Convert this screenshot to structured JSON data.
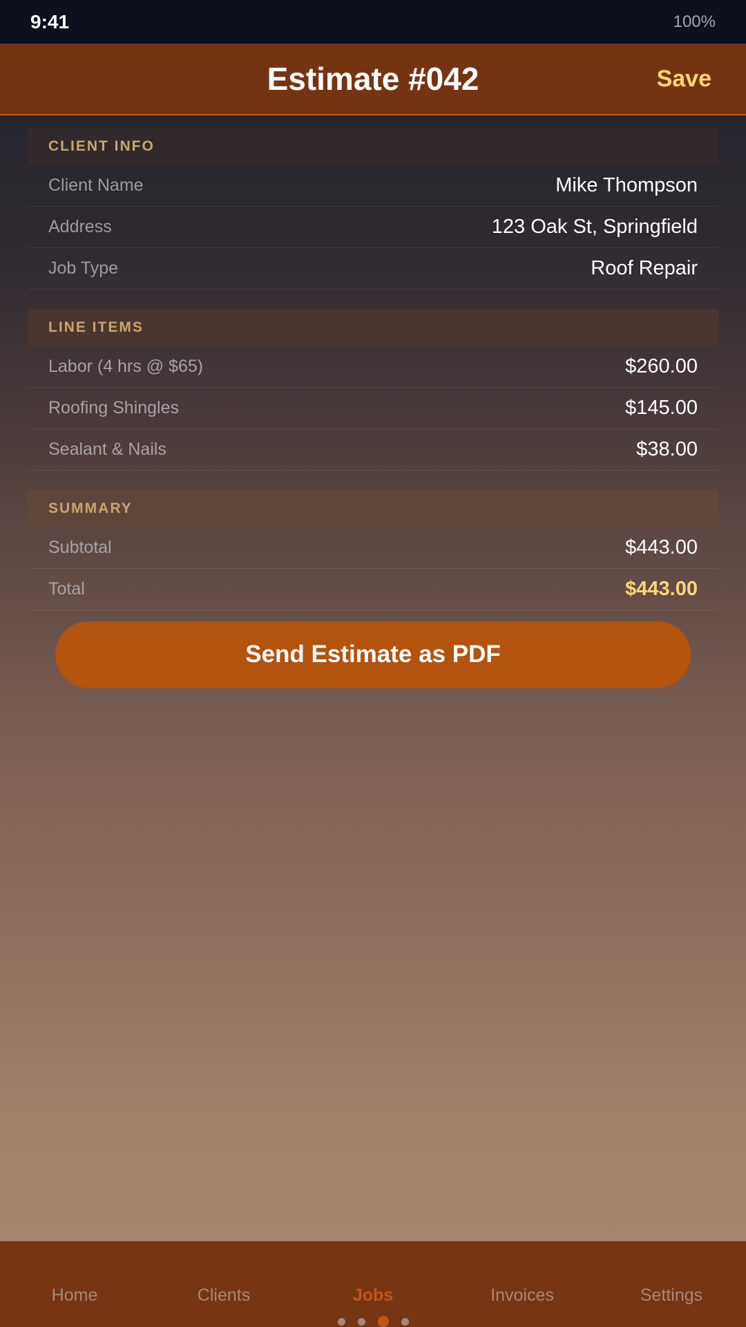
{
  "status_bar": {
    "time": "9:41",
    "battery": "100%"
  },
  "header": {
    "title": "Estimate #042",
    "save_label": "Save"
  },
  "sections": {
    "client_info": {
      "title": "CLIENT INFO",
      "rows": [
        {
          "label": "Client Name",
          "value": "Mike Thompson"
        },
        {
          "label": "Address",
          "value": "123 Oak St, Springfield"
        },
        {
          "label": "Job Type",
          "value": "Roof Repair"
        }
      ]
    },
    "line_items": {
      "title": "LINE ITEMS",
      "rows": [
        {
          "label": "Labor (4 hrs @ $65)",
          "value": "$260.00"
        },
        {
          "label": "Roofing Shingles",
          "value": "$145.00"
        },
        {
          "label": "Sealant & Nails",
          "value": "$38.00"
        }
      ]
    },
    "summary": {
      "title": "SUMMARY",
      "rows": [
        {
          "label": "Subtotal",
          "value": "$443.00"
        },
        {
          "label": "Total",
          "value": "$443.00"
        }
      ]
    }
  },
  "send_button_label": "Send Estimate as PDF",
  "tab_bar": {
    "tabs": [
      {
        "label": "Home"
      },
      {
        "label": "Clients"
      },
      {
        "label": "Jobs"
      },
      {
        "label": "Invoices"
      },
      {
        "label": "Settings"
      }
    ],
    "active_tab": "Jobs"
  },
  "page_indicator": {
    "total": 4,
    "current": 3
  },
  "colors": {
    "accent": "#b3530e",
    "header_bg": "#753411",
    "highlight": "#ffd67a",
    "section_label": "#c9a56a"
  }
}
